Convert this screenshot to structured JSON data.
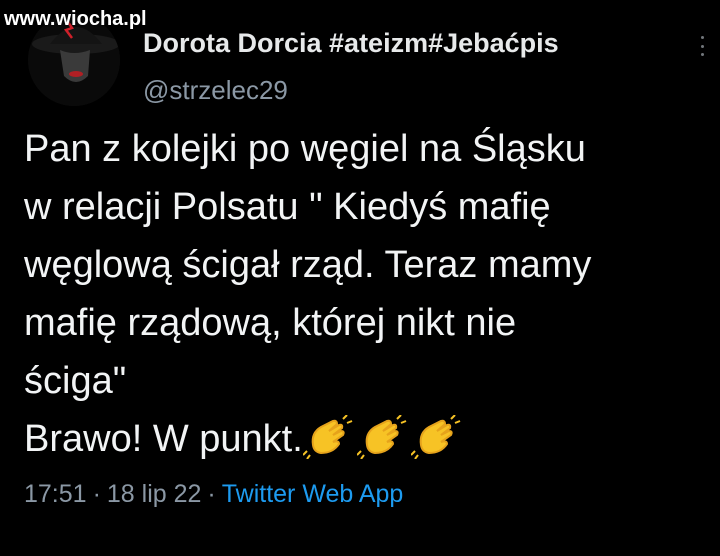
{
  "watermark": {
    "text": "www.wiocha.pl"
  },
  "author": {
    "display_name": "Dorota Dorcia #ateizm#Jebaćpis",
    "handle": "@strzelec29"
  },
  "tweet": {
    "lines": [
      "Pan z kolejki po węgiel na Śląsku",
      "w relacji Polsatu \" Kiedyś mafię",
      "węglową ścigał rząd. Teraz mamy",
      "mafię rządową, której nikt nie",
      "ściga\"",
      "Brawo! W punkt."
    ],
    "emojis": [
      "clapping-hands",
      "clapping-hands",
      "clapping-hands"
    ]
  },
  "meta": {
    "time": "17:51",
    "date": "18 lip 22",
    "separator": "·",
    "source": "Twitter Web App"
  },
  "colors": {
    "background": "#000000",
    "text": "#e7e9ea",
    "secondary": "#8b98a5",
    "link": "#1d9bf0"
  }
}
